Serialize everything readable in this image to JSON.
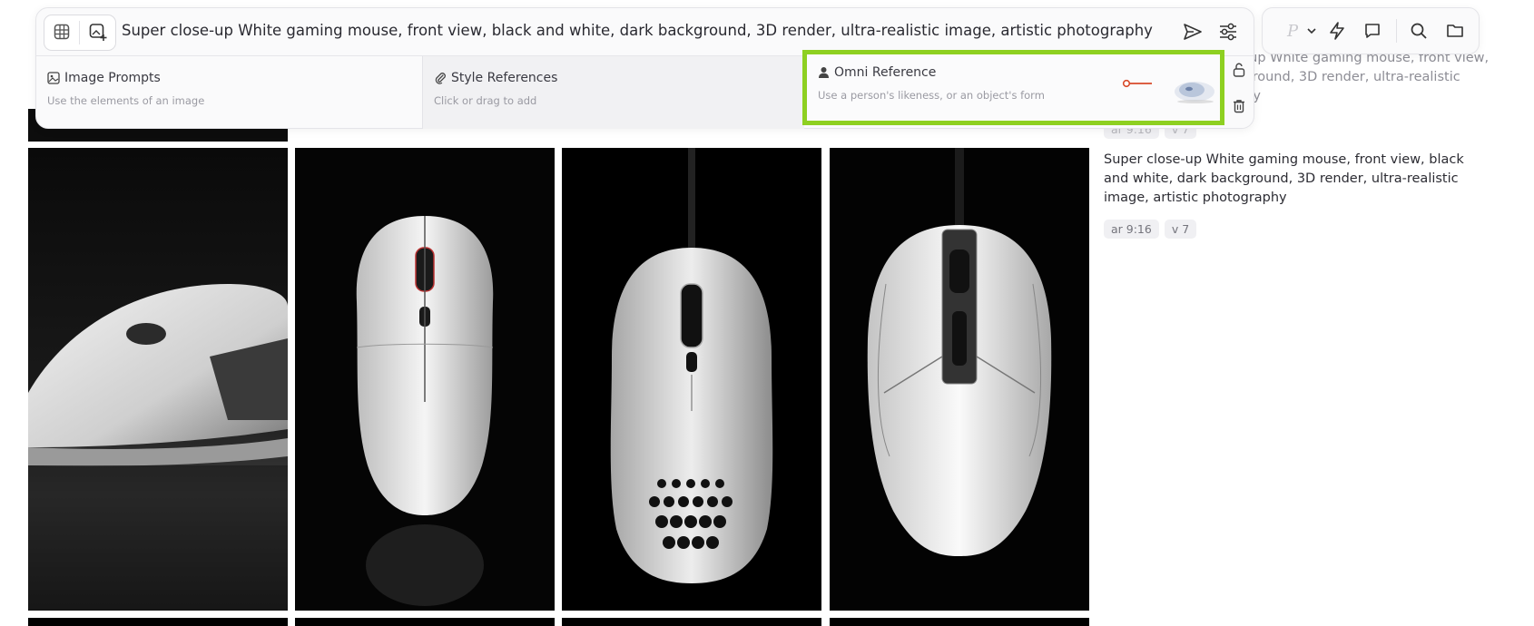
{
  "prompt": {
    "text": "Super close-up White gaming mouse, front view, black and white, dark background, 3D render, ultra-realistic image, artistic photography"
  },
  "references": {
    "image_prompts": {
      "title": "Image Prompts",
      "subtitle": "Use the elements of an image"
    },
    "style_references": {
      "title": "Style References",
      "subtitle": "Click or drag to add"
    },
    "omni_reference": {
      "title": "Omni Reference",
      "subtitle": "Use a person's likeness, or an object's form"
    }
  },
  "toolbar": {
    "profile_letter": "P"
  },
  "side_panel": {
    "faded_text_lines": [
      "e-up White gaming mouse, front view,",
      "kground, 3D render, ultra-realistic",
      "phy"
    ],
    "faded_tags": [
      "ar 9:16",
      "v 7"
    ],
    "prompt_text": "Super close-up White gaming mouse, front view, black and white, dark background, 3D render, ultra-realistic image, artistic photography",
    "tags": [
      "ar 9:16",
      "v 7"
    ]
  },
  "colors": {
    "highlight": "#8ed021",
    "slider_accent": "#d84a2a"
  }
}
